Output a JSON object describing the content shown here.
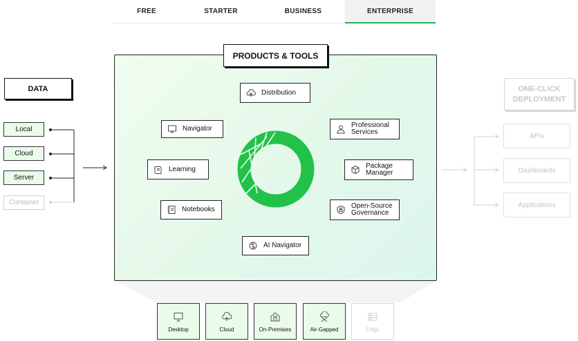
{
  "tabs": [
    {
      "label": "FREE",
      "active": false
    },
    {
      "label": "STARTER",
      "active": false
    },
    {
      "label": "BUSINESS",
      "active": false
    },
    {
      "label": "ENTERPRISE",
      "active": true
    }
  ],
  "data": {
    "title": "DATA",
    "sources": [
      {
        "label": "Local",
        "enabled": true
      },
      {
        "label": "Cloud",
        "enabled": true
      },
      {
        "label": "Server",
        "enabled": true
      },
      {
        "label": "Container",
        "enabled": false
      }
    ]
  },
  "products": {
    "title": "PRODUCTS & TOOLS",
    "tools": {
      "distribution": {
        "label": "Distribution",
        "icon": "cloud-upload-icon"
      },
      "navigator": {
        "label": "Navigator",
        "icon": "monitor-icon"
      },
      "learning": {
        "label": "Learning",
        "icon": "book-icon"
      },
      "notebooks": {
        "label": "Notebooks",
        "icon": "notebook-icon"
      },
      "ai_navigator": {
        "label": "AI Navigator",
        "icon": "brain-icon"
      },
      "professional_services": {
        "label1": "Professional",
        "label2": "Services",
        "icon": "person-icon"
      },
      "package_manager": {
        "label1": "Package",
        "label2": "Manager",
        "icon": "package-icon"
      },
      "governance": {
        "label1": "Open-Source",
        "label2": "Governance",
        "icon": "shield-lock-icon"
      }
    },
    "accent": "#22c24a"
  },
  "deployment": {
    "title_line1": "ONE-CLICK",
    "title_line2": "DEPLOYMENT",
    "outputs": [
      "APIs",
      "Dashboards",
      "Applications"
    ]
  },
  "targets": [
    {
      "label": "Desktop",
      "icon": "desktop-icon",
      "enabled": true
    },
    {
      "label": "Cloud",
      "icon": "cloud-icon",
      "enabled": true
    },
    {
      "label": "On-Premises",
      "icon": "building-icon",
      "enabled": true
    },
    {
      "label": "Air-Gapped",
      "icon": "air-gapped-icon",
      "enabled": true
    },
    {
      "label": "Edge",
      "icon": "edge-icon",
      "enabled": false
    }
  ]
}
